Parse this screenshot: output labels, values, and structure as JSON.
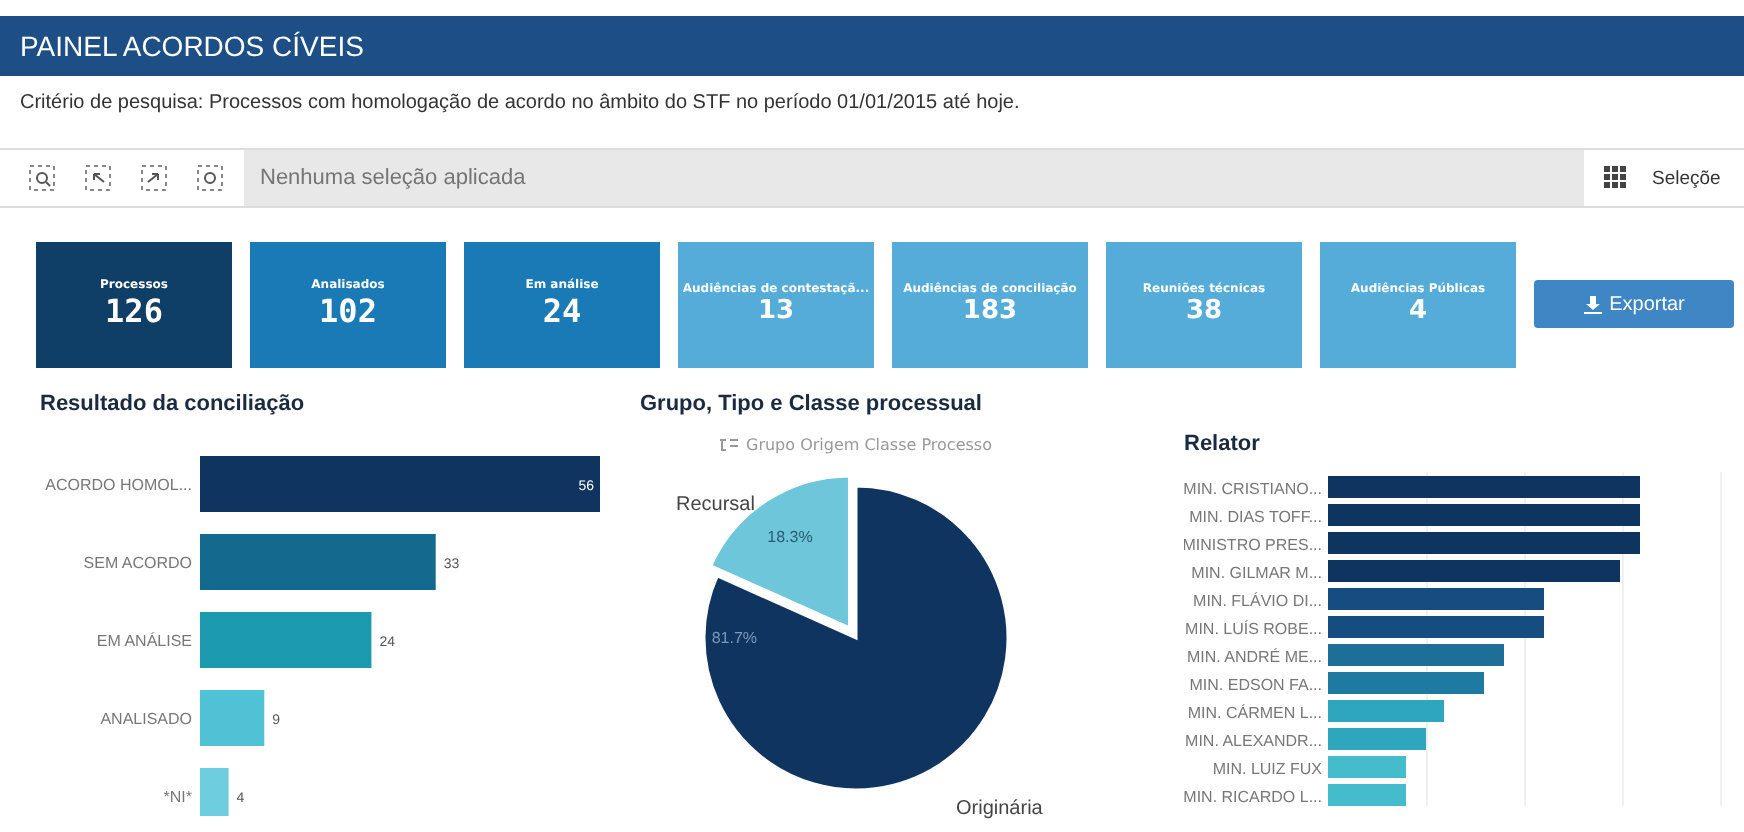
{
  "header": {
    "title": "PAINEL ACORDOS CÍVEIS"
  },
  "criteria": "Critério de pesquisa: Processos com homologação de acordo no âmbito do STF no período 01/01/2015 até hoje.",
  "selection_bar": {
    "placeholder": "Nenhuma seleção aplicada",
    "selections_label": "Seleçõe"
  },
  "kpis": [
    {
      "label": "Processos",
      "value": "126",
      "color": "#0f3e66"
    },
    {
      "label": "Analisados",
      "value": "102",
      "color": "#1a7ab5"
    },
    {
      "label": "Em análise",
      "value": "24",
      "color": "#1a7ab5"
    },
    {
      "label": "Audiências de contestaçã...",
      "value": "13",
      "color": "#55acd8"
    },
    {
      "label": "Audiências de conciliação",
      "value": "183",
      "color": "#55acd8"
    },
    {
      "label": "Reuniões técnicas",
      "value": "38",
      "color": "#55acd8"
    },
    {
      "label": "Audiências Públicas",
      "value": "4",
      "color": "#55acd8"
    }
  ],
  "export_button": "Exportar",
  "result_panel": {
    "title": "Resultado da conciliação",
    "chart_data": {
      "type": "bar",
      "orientation": "horizontal",
      "stacked": true,
      "categories": [
        "ACORDO HOMOL...",
        "SEM ACORDO",
        "EM ANÁLISE",
        "ANALISADO",
        "*NI*"
      ],
      "series": [
        {
          "color": "#0f3460",
          "values": [
            56,
            null,
            null,
            null,
            null
          ]
        },
        {
          "color": "#146a8e",
          "values": [
            null,
            33,
            null,
            null,
            null
          ]
        },
        {
          "color": "#1c9bb0",
          "values": [
            null,
            null,
            24,
            null,
            null
          ]
        },
        {
          "color": "#4fc2d6",
          "values": [
            null,
            null,
            null,
            9,
            null
          ]
        },
        {
          "color": "#6fcde0",
          "values": [
            null,
            null,
            null,
            null,
            4
          ]
        }
      ],
      "data_labels": true
    }
  },
  "group_panel": {
    "title": "Grupo, Tipo e Classe processual",
    "legend_title": "Grupo Origem Classe Processo",
    "chart_data": {
      "type": "pie",
      "categories": [
        "Originária",
        "Recursal"
      ],
      "series": [
        {
          "values": [
            81.7,
            18.3
          ]
        }
      ],
      "value_labels": [
        "81.7%",
        "18.3%"
      ]
    }
  },
  "relator_panel": {
    "title": "Relator",
    "items": [
      {
        "name": "MIN. CRISTIANO...",
        "color": "#0e3460"
      },
      {
        "name": "MIN. DIAS TOFF...",
        "color": "#0e3460"
      },
      {
        "name": "MINISTRO PRES...",
        "color": "#0e3460"
      },
      {
        "name": "MIN. GILMAR M...",
        "color": "#0e3460"
      },
      {
        "name": "MIN. FLÁVIO DI...",
        "color": "#164d80"
      },
      {
        "name": "MIN. LUÍS ROBE...",
        "color": "#164d80"
      },
      {
        "name": "MIN. ANDRÉ ME...",
        "color": "#1e6f98"
      },
      {
        "name": "MIN. EDSON FA...",
        "color": "#1e7aa0"
      },
      {
        "name": "MIN. CÁRMEN L...",
        "color": "#2ea6be"
      },
      {
        "name": "MIN. ALEXANDR...",
        "color": "#2ea6be"
      },
      {
        "name": "MIN. LUIZ FUX",
        "color": "#45bccc"
      },
      {
        "name": "MIN. RICARDO L...",
        "color": "#45bccc"
      }
    ]
  }
}
